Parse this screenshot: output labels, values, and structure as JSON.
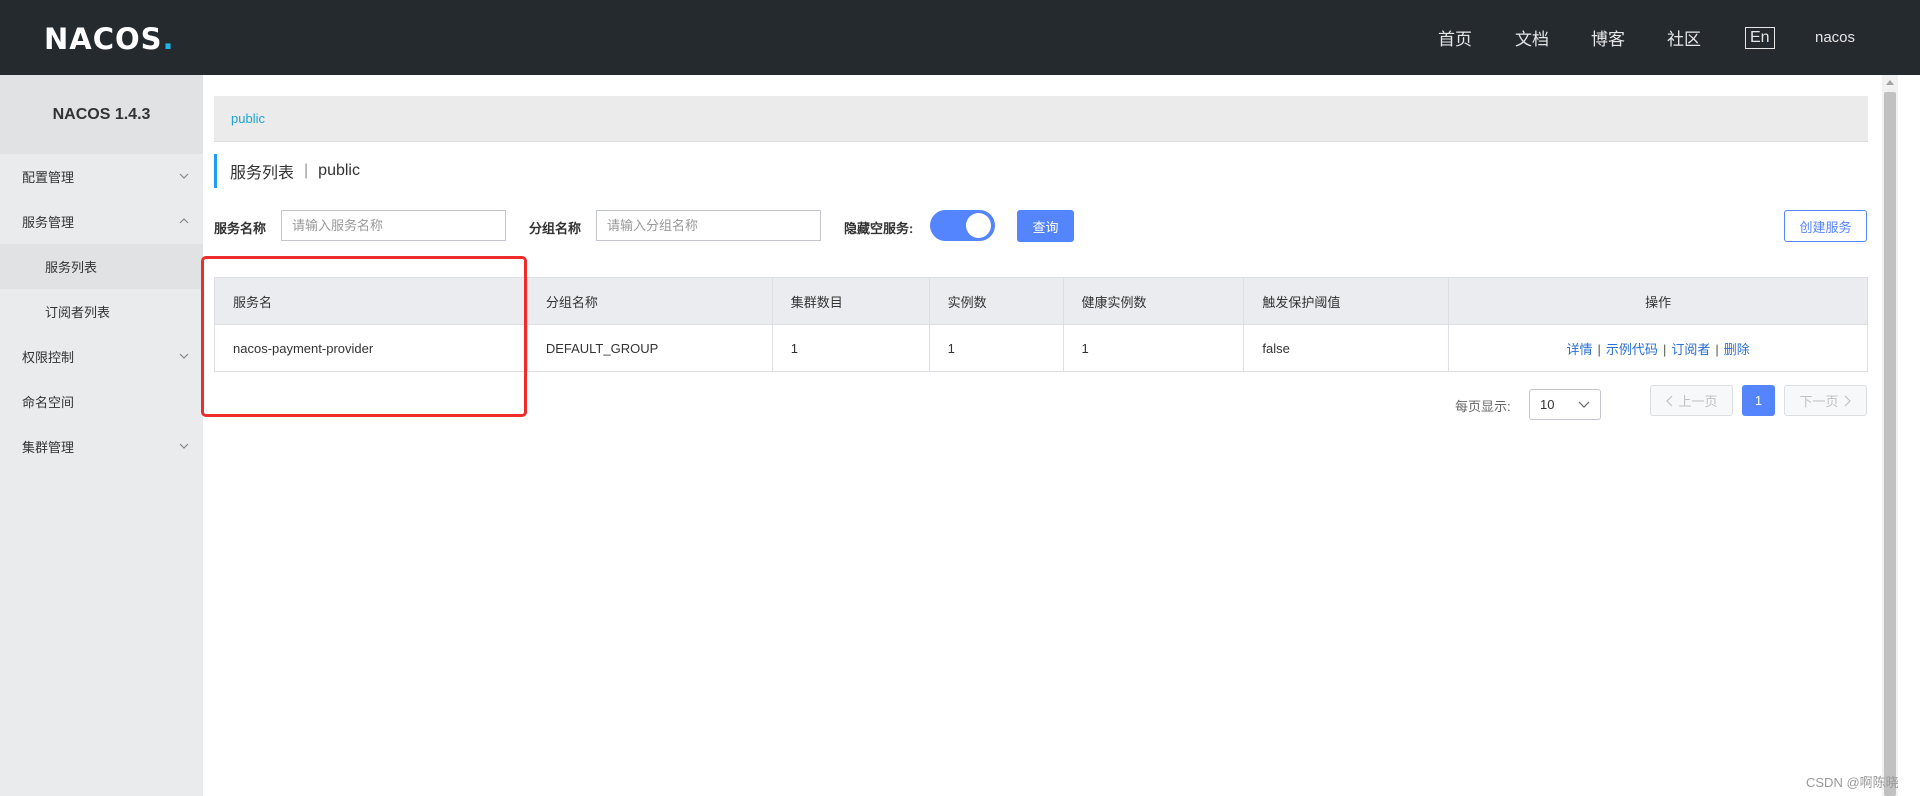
{
  "header": {
    "logo": "NACOS",
    "logo_dot": ".",
    "nav": [
      "首页",
      "文档",
      "博客",
      "社区"
    ],
    "lang": "En",
    "user": "nacos"
  },
  "sidebar": {
    "version": "NACOS 1.4.3",
    "items": [
      {
        "label": "配置管理",
        "chevron": "down"
      },
      {
        "label": "服务管理",
        "chevron": "up"
      },
      {
        "label": "服务列表",
        "active": true
      },
      {
        "label": "订阅者列表"
      },
      {
        "label": "权限控制",
        "chevron": "down"
      },
      {
        "label": "命名空间"
      },
      {
        "label": "集群管理",
        "chevron": "down"
      }
    ]
  },
  "breadcrumb": "public",
  "title": {
    "main": "服务列表",
    "sep": "|",
    "namespace": "public"
  },
  "filters": {
    "service_label": "服务名称",
    "service_placeholder": "请输入服务名称",
    "group_label": "分组名称",
    "group_placeholder": "请输入分组名称",
    "hide_empty_label": "隐藏空服务:",
    "hide_empty_on": true,
    "query_button": "查询",
    "create_button": "创建服务"
  },
  "table": {
    "columns": [
      "服务名",
      "分组名称",
      "集群数目",
      "实例数",
      "健康实例数",
      "触发保护阈值",
      "操作"
    ],
    "rows": [
      {
        "name": "nacos-payment-provider",
        "group": "DEFAULT_GROUP",
        "clusters": "1",
        "instances": "1",
        "healthy": "1",
        "threshold": "false"
      }
    ],
    "actions": [
      "详情",
      "示例代码",
      "订阅者",
      "删除"
    ],
    "action_sep": "|"
  },
  "pagination": {
    "per_page_label": "每页显示:",
    "per_page": "10",
    "prev": "上一页",
    "current": "1",
    "next": "下一页"
  },
  "watermark": "CSDN @啊陈晓",
  "colors": {
    "accent": "#5584ff",
    "topbar": "#252a2f",
    "highlight": "#ee2c2c"
  }
}
